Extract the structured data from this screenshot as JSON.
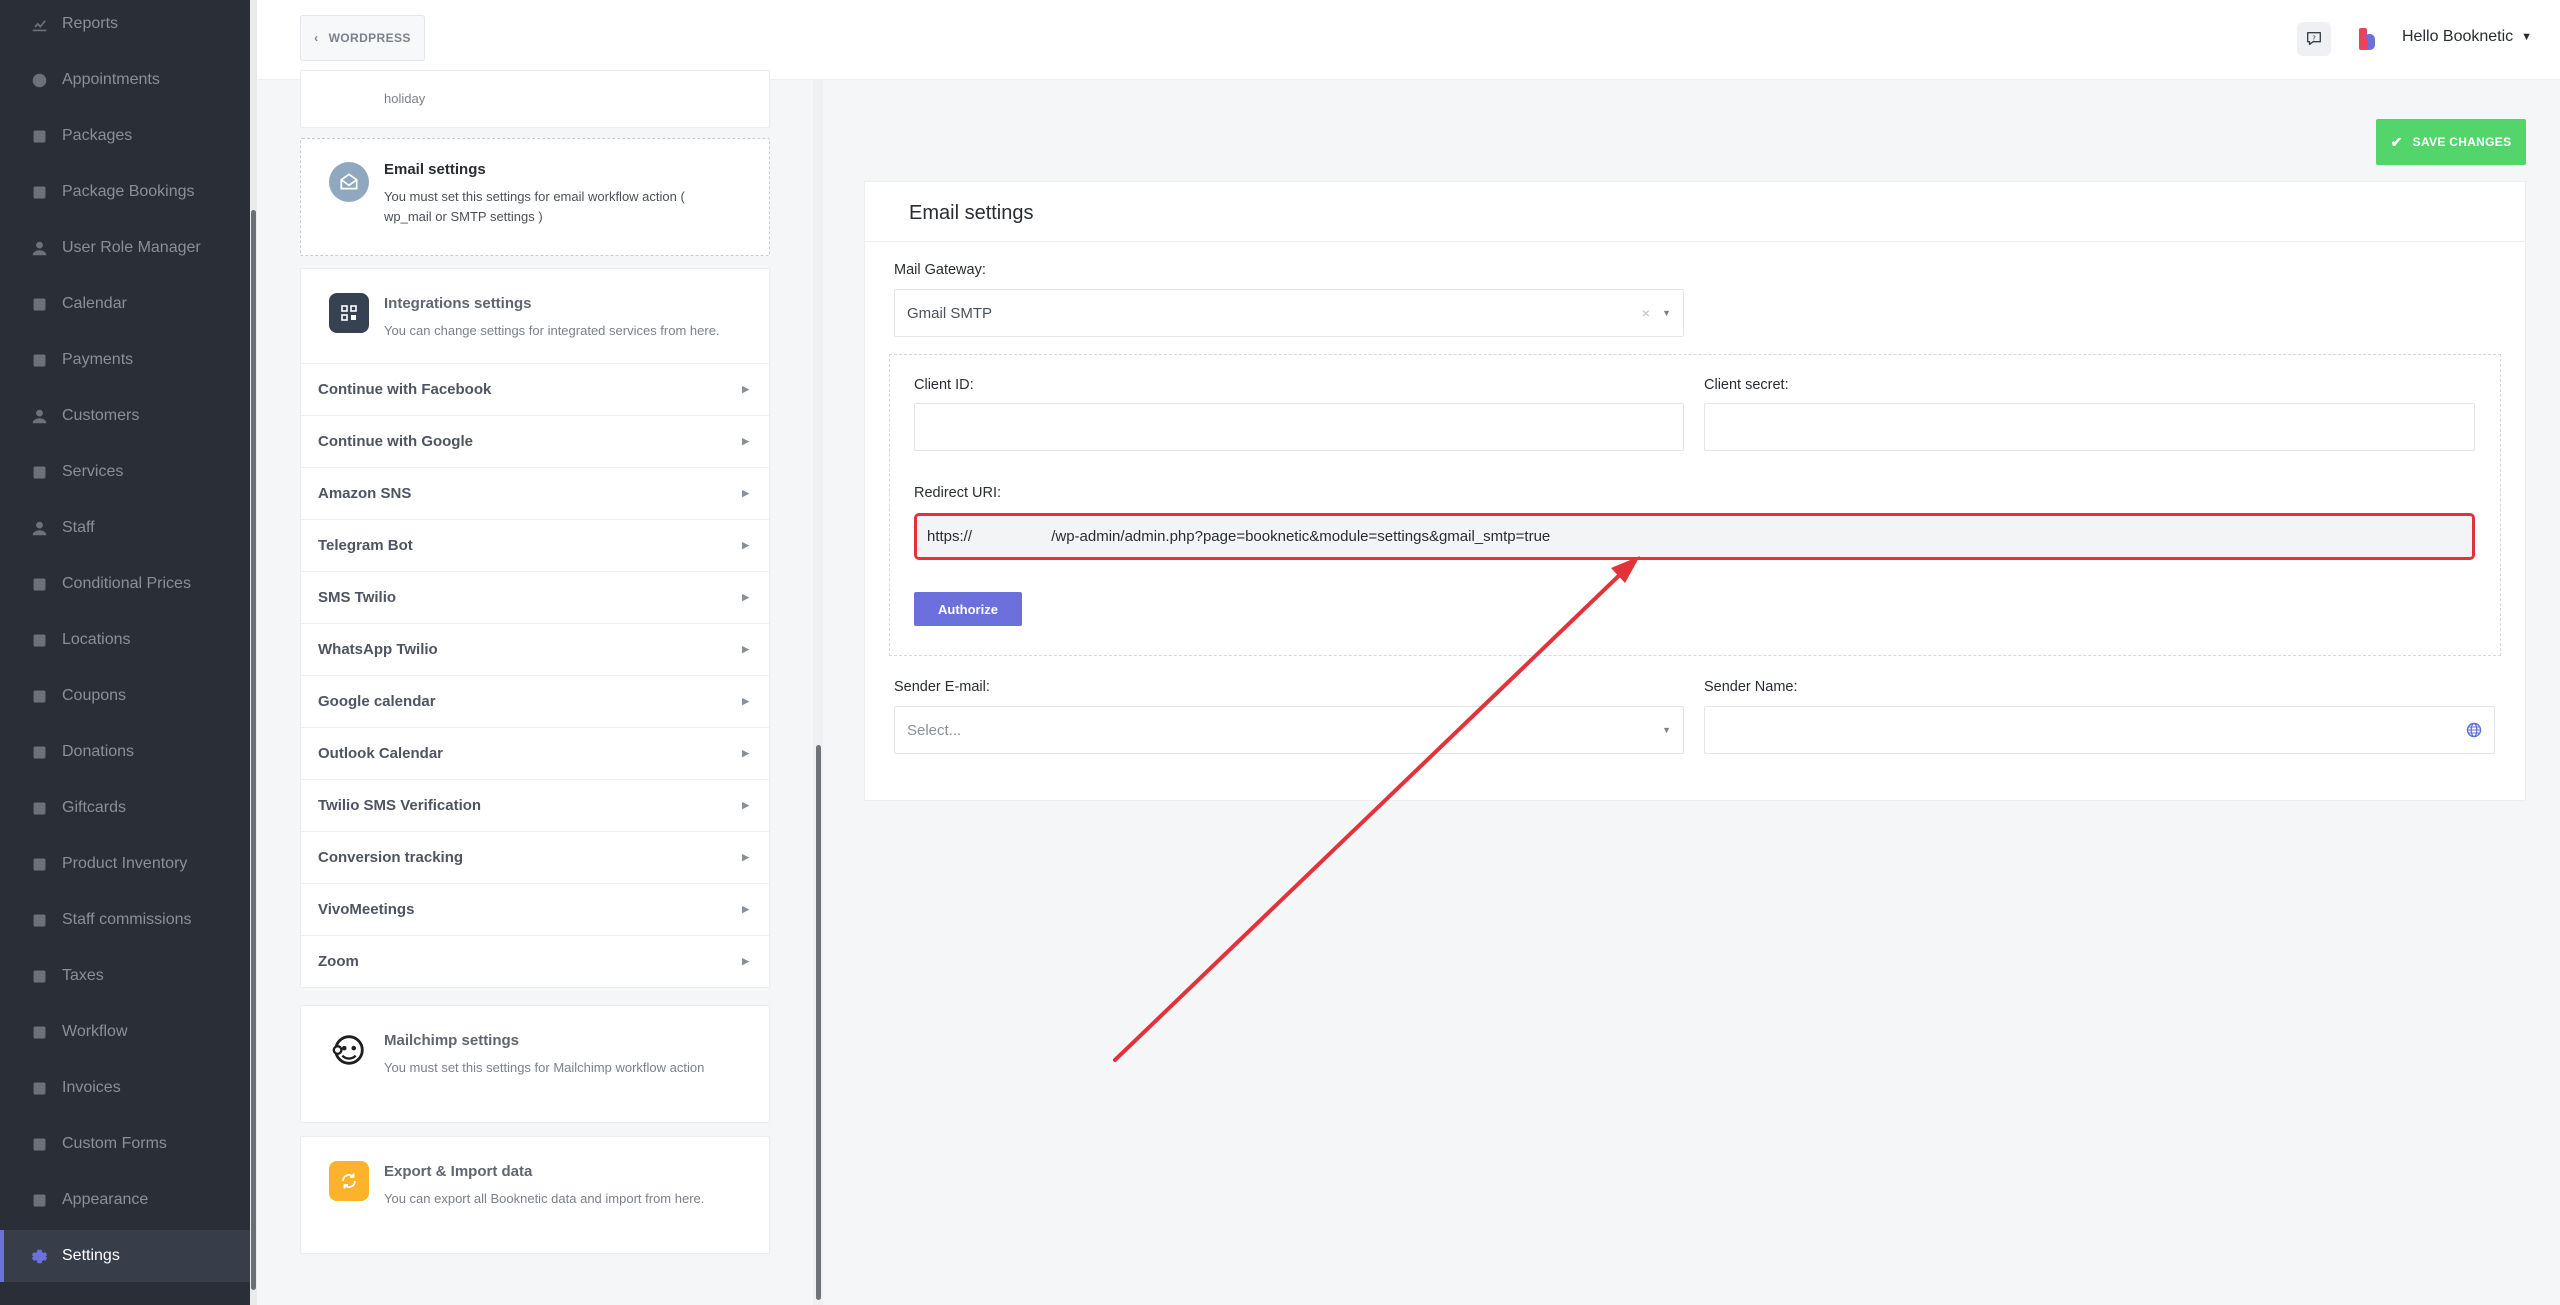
{
  "sidebar": {
    "items": [
      {
        "label": "Reports",
        "icon": "chart-line-icon"
      },
      {
        "label": "Appointments",
        "icon": "clock-icon"
      },
      {
        "label": "Packages",
        "icon": "boxes-icon"
      },
      {
        "label": "Package Bookings",
        "icon": "package-booking-icon"
      },
      {
        "label": "User Role Manager",
        "icon": "user-cog-icon"
      },
      {
        "label": "Calendar",
        "icon": "calendar-icon"
      },
      {
        "label": "Payments",
        "icon": "credit-card-icon"
      },
      {
        "label": "Customers",
        "icon": "users-icon"
      },
      {
        "label": "Services",
        "icon": "list-icon"
      },
      {
        "label": "Staff",
        "icon": "user-icon"
      },
      {
        "label": "Conditional Prices",
        "icon": "dollar-icon"
      },
      {
        "label": "Locations",
        "icon": "location-arrow-icon"
      },
      {
        "label": "Coupons",
        "icon": "tag-icon"
      },
      {
        "label": "Donations",
        "icon": "donation-icon"
      },
      {
        "label": "Giftcards",
        "icon": "gift-icon"
      },
      {
        "label": "Product Inventory",
        "icon": "tools-icon"
      },
      {
        "label": "Staff commissions",
        "icon": "handshake-icon"
      },
      {
        "label": "Taxes",
        "icon": "percent-icon"
      },
      {
        "label": "Workflow",
        "icon": "workflow-icon"
      },
      {
        "label": "Invoices",
        "icon": "invoice-icon"
      },
      {
        "label": "Custom Forms",
        "icon": "form-icon"
      },
      {
        "label": "Appearance",
        "icon": "brush-icon"
      },
      {
        "label": "Settings",
        "icon": "gear-icon",
        "active": true
      }
    ]
  },
  "topbar": {
    "back_label": "WORDPRESS",
    "user_greeting": "Hello Booknetic"
  },
  "settings_list": {
    "holiday_card_tail": "holiday",
    "email_card": {
      "title": "Email settings",
      "desc": "You must set this settings for email workflow action ( wp_mail or SMTP settings )"
    },
    "integrations_card": {
      "title": "Integrations settings",
      "desc": "You can change settings for integrated services from here.",
      "items": [
        "Continue with Facebook",
        "Continue with Google",
        "Amazon SNS",
        "Telegram Bot",
        "SMS Twilio",
        "WhatsApp Twilio",
        "Google calendar",
        "Outlook Calendar",
        "Twilio SMS Verification",
        "Conversion tracking",
        "VivoMeetings",
        "Zoom"
      ]
    },
    "mailchimp_card": {
      "title": "Mailchimp settings",
      "desc": "You must set this settings for Mailchimp workflow action"
    },
    "export_card": {
      "title": "Export & Import data",
      "desc": "You can export all Booknetic data and import from here."
    }
  },
  "main": {
    "save_label": "SAVE CHANGES",
    "title": "Email settings",
    "mail_gateway_label": "Mail Gateway:",
    "mail_gateway_value": "Gmail SMTP",
    "client_id_label": "Client ID:",
    "client_id_value": "",
    "client_secret_label": "Client secret:",
    "client_secret_value": "",
    "redirect_uri_label": "Redirect URI:",
    "redirect_uri_value": "https://                   /wp-admin/admin.php?page=booknetic&module=settings&gmail_smtp=true",
    "authorize_label": "Authorize",
    "sender_email_label": "Sender E-mail:",
    "sender_email_placeholder": "Select...",
    "sender_name_label": "Sender Name:",
    "sender_name_value": ""
  },
  "colors": {
    "sidebar_bg": "#292e37",
    "accent": "#6c70dc",
    "save_green": "#53d56c",
    "highlight_red": "#e2333a"
  }
}
